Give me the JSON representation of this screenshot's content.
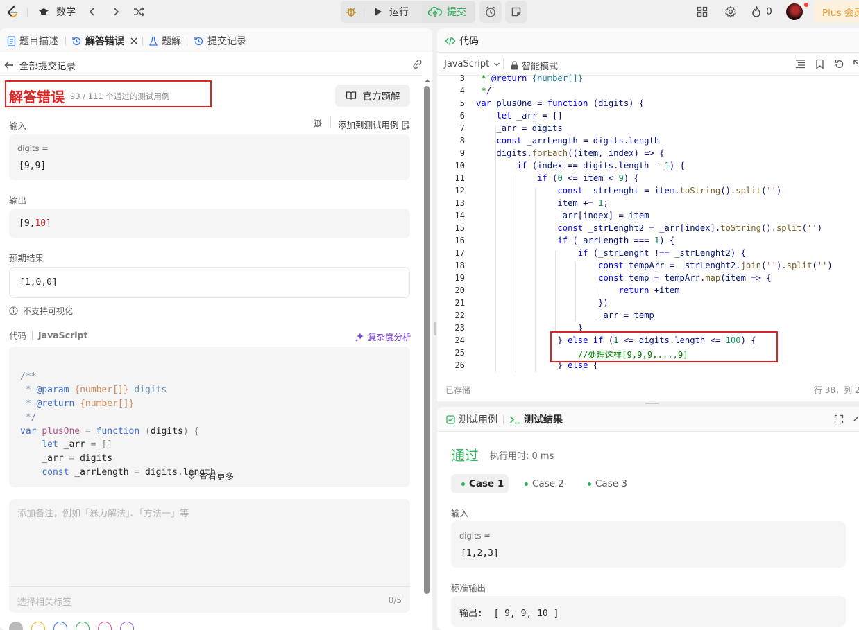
{
  "topbar": {
    "title": "数学",
    "run_label": "运行",
    "submit_label": "提交",
    "streak": "0",
    "plus_label": "Plus 会员"
  },
  "left_tabs": {
    "description": "题目描述",
    "wrong_answer": "解答错误",
    "solutions": "题解",
    "submissions": "提交记录"
  },
  "submission": {
    "back_label": "全部提交记录",
    "status": "解答错误",
    "passed_text": "93 / 111 个通过的测试用例",
    "official_solution": "官方题解",
    "input_label": "输入",
    "add_testcase": "添加到测试用例",
    "input_var": "digits =",
    "input_value": "[9,9]",
    "output_label": "输出",
    "output_prefix": "[9,",
    "output_wrong": "10",
    "output_suffix": "]",
    "expected_label": "预期结果",
    "expected_value": "[1,0,0]",
    "no_visual": "不支持可视化",
    "code_label": "代码",
    "code_lang": "JavaScript",
    "complexity": "复杂度分析",
    "view_more": "查看更多",
    "note_placeholder": "添加备注，例如「暴力解法」、「方法一」等",
    "tag_placeholder": "选择相关标签",
    "tag_count": "0/5"
  },
  "code_preview": [
    "/**",
    " * @param {number[]} digits",
    " * @return {number[]}",
    " */",
    "var plusOne = function (digits) {",
    "    let _arr = []",
    "    _arr = digits",
    "    const _arrLength = digits.length"
  ],
  "editor": {
    "tab_label": "代码",
    "language": "JavaScript",
    "mode": "智能模式",
    "saved": "已存储",
    "cursor": "行 38，列 26",
    "line_numbers": [
      "3",
      "4",
      "5",
      "6",
      "7",
      "8",
      "9",
      "10",
      "11",
      "12",
      "13",
      "14",
      "15",
      "16",
      "17",
      "18",
      "19",
      "20",
      "21",
      "22",
      "23",
      "24",
      "25",
      "26"
    ],
    "lines": [
      " * @return {number[]}",
      " */",
      "var plusOne = function (digits) {",
      "    let _arr = []",
      "    _arr = digits",
      "    const _arrLength = digits.length",
      "    digits.forEach((item, index) => {",
      "        if (index == digits.length - 1) {",
      "            if (0 <= item < 9) {",
      "                const _strLenght = item.toString().split('')",
      "                item += 1;",
      "                _arr[index] = item",
      "                const _strLenght2 = _arr[index].toString().split('')",
      "                if (_arrLength === 1) {",
      "                    if (_strLenght !== _strLenght2) {",
      "                        const tempArr = _strLenght2.join('').split('')",
      "                        const temp = tempArr.map(item => {",
      "                            return +item",
      "                        })",
      "                        _arr = temp",
      "                    }",
      "                } else if (1 <= digits.length <= 100) {",
      "                    //处理这样[9,9,9,...,9]",
      "                } else {"
    ]
  },
  "results": {
    "tab_testcase": "测试用例",
    "tab_result": "测试结果",
    "status": "通过",
    "runtime": "执行用时: 0 ms",
    "cases": [
      "Case 1",
      "Case 2",
      "Case 3"
    ],
    "input_label": "输入",
    "input_var": "digits =",
    "input_value": "[1,2,3]",
    "stdout_label": "标准输出",
    "stdout_value": "输出:  [ 9, 9, 10 ]"
  },
  "colors": {
    "error_red": "#e02424",
    "pass_green": "#2db55d",
    "submit_green": "#2db55d",
    "link_purple": "#7b3fe4"
  }
}
